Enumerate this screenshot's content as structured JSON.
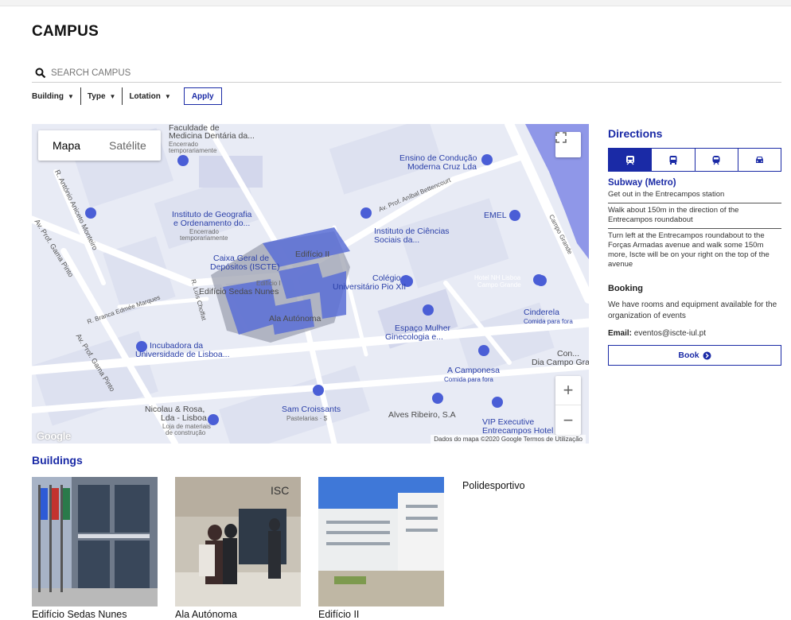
{
  "page": {
    "title": "CAMPUS"
  },
  "search": {
    "placeholder": "SEARCH CAMPUS"
  },
  "filters": [
    {
      "label": "Building"
    },
    {
      "label": "Type"
    },
    {
      "label": "Lotation"
    }
  ],
  "apply_label": "Apply",
  "map": {
    "toggle_map": "Mapa",
    "toggle_satellite": "Satélite",
    "zoom_in": "+",
    "zoom_out": "−",
    "google": "Google",
    "footer": "Dados do mapa ©2020 Google   Termos de Utilização",
    "labels": {
      "faculdade": "Faculdade de",
      "faculdade2": "Medicina Dentária da...",
      "faculdade_status": "Encerrado",
      "faculdade_status2": "temporariamente",
      "ensino": "Ensino de Condução",
      "ensino2": "Moderna Cruz Lda",
      "geografia": "Instituto de Geografia",
      "geografia2": "e Ordenamento do...",
      "geografia_status": "Encerrado",
      "geografia_status2": "temporariamente",
      "ciencias": "Instituto de Ciências",
      "ciencias2": "Sociais da...",
      "emel": "EMEL",
      "caixa": "Caixa Geral de",
      "caixa2": "Depósitos (ISCTE)",
      "edificio_ii": "Edifício II",
      "edificio_i": "Edifício I",
      "sedas": "Edifício Sedas Nunes",
      "colegio": "Colégio",
      "colegio2": "Universitário Pio XII",
      "hotel_nh": "Hotel NH Lisboa",
      "hotel_nh2": "Campo Grande",
      "ala": "Ala Autónoma",
      "cinderela": "Cinderela",
      "cinderela2": "Comida para fora",
      "espaco": "Espaço Mulher",
      "espaco2": "Ginecologia e...",
      "incubadora": "Incubadora da",
      "incubadora2": "Universidade de Lisboa...",
      "condominio": "Con...",
      "condominio2": "Dia Campo Gra",
      "camponesa": "A Camponesa",
      "camponesa2": "Comida para fora",
      "nicolau": "Nicolau & Rosa,",
      "nicolau2": "Lda - Lisboa",
      "nicolau3": "Loja de materiais",
      "nicolau4": "de construção",
      "croissants": "Sam Croissants",
      "croissants2": "Pastelarias · $",
      "alves": "Alves Ribeiro, S.A",
      "vip": "VIP Executive",
      "vip2": "Entrecampos Hotel &...",
      "street_gama1": "Av. Prof. Gama Pinto",
      "street_gama2": "Av. Prof. Gama Pinto",
      "street_aniceto": "R. António Aniceto Monteiro",
      "street_bettencourt": "Av. Prof. Aníbal Bettencourt",
      "street_branca": "R. Branca Edmée Marques",
      "street_choffat": "R. Luís Choffat",
      "street_campo": "Campo Grande"
    }
  },
  "directions": {
    "title": "Directions",
    "modes": [
      {
        "icon": "subway-icon"
      },
      {
        "icon": "bus-icon"
      },
      {
        "icon": "train-icon"
      },
      {
        "icon": "car-icon"
      }
    ],
    "subway_title": "Subway (Metro)",
    "steps": [
      "Get out in the Entrecampos station",
      "Walk about 150m in the direction of the Entrecampos roundabout",
      "Turn left at the Entrecampos roundabout to the Forças Armadas avenue and walk some 150m more, Iscte will be on your right on the top of the avenue"
    ],
    "booking_title": "Booking",
    "booking_text": "We have rooms and equipment available for the organization of events",
    "email_label": "Email:",
    "email_value": "eventos@iscte-iul.pt",
    "book_label": "Book"
  },
  "buildings": {
    "title": "Buildings",
    "items": [
      {
        "name": "Edifício Sedas Nunes"
      },
      {
        "name": "Ala Autónoma"
      },
      {
        "name": "Edifício II"
      },
      {
        "name": "Polidesportivo"
      }
    ]
  },
  "colors": {
    "accent": "#1a2aa6",
    "map_water": "#8a93e6",
    "map_building": "#5b6fd6"
  }
}
